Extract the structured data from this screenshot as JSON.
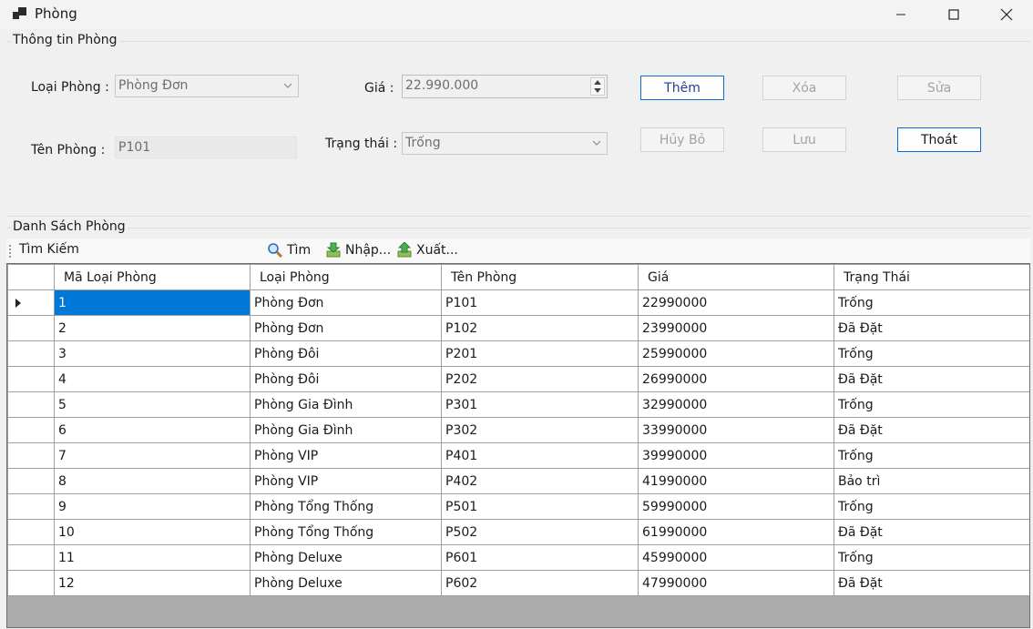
{
  "window": {
    "title": "Phòng"
  },
  "info_group": {
    "title": "Thông tin Phòng",
    "loai_phong_label": "Loại Phòng :",
    "loai_phong_value": "Phòng Đơn",
    "gia_label": "Giá :",
    "gia_value": "22.990.000",
    "ten_phong_label": "Tên Phòng :",
    "ten_phong_value": "P101",
    "trang_thai_label": "Trạng thái :",
    "trang_thai_value": "Trống"
  },
  "buttons": {
    "them": "Thêm",
    "xoa": "Xóa",
    "sua": "Sửa",
    "huy_bo": "Hủy Bỏ",
    "luu": "Lưu",
    "thoat": "Thoát"
  },
  "list_group": {
    "title": "Danh Sách Phòng"
  },
  "toolbar": {
    "search_label": "Tìm Kiếm",
    "tim": "Tìm",
    "nhap": "Nhập...",
    "xuat": "Xuất..."
  },
  "table": {
    "columns": [
      "Mã Loại Phòng",
      "Loại Phòng",
      "Tên Phòng",
      "Giá",
      "Trạng Thái"
    ],
    "rows": [
      [
        "1",
        "Phòng Đơn",
        "P101",
        "22990000",
        "Trống"
      ],
      [
        "2",
        "Phòng Đơn",
        "P102",
        "23990000",
        "Đã Đặt"
      ],
      [
        "3",
        "Phòng Đôi",
        "P201",
        "25990000",
        "Trống"
      ],
      [
        "4",
        "Phòng Đôi",
        "P202",
        "26990000",
        "Đã Đặt"
      ],
      [
        "5",
        "Phòng Gia Đình",
        "P301",
        "32990000",
        "Trống"
      ],
      [
        "6",
        "Phòng Gia Đình",
        "P302",
        "33990000",
        "Đã Đặt"
      ],
      [
        "7",
        "Phòng VIP",
        "P401",
        "39990000",
        "Trống"
      ],
      [
        "8",
        "Phòng VIP",
        "P402",
        "41990000",
        "Bảo trì"
      ],
      [
        "9",
        "Phòng Tổng Thống",
        "P501",
        "59990000",
        "Trống"
      ],
      [
        "10",
        "Phòng Tổng Thống",
        "P502",
        "61990000",
        "Đã Đặt"
      ],
      [
        "11",
        "Phòng Deluxe",
        "P601",
        "45990000",
        "Trống"
      ],
      [
        "12",
        "Phòng Deluxe",
        "P602",
        "47990000",
        "Đã Đặt"
      ]
    ]
  },
  "colors": {
    "selection": "#0078d7",
    "focus_border": "#0b6cd1"
  },
  "icons": [
    "app-icon",
    "minimize-icon",
    "maximize-icon",
    "close-icon",
    "search-icon",
    "import-icon",
    "export-icon",
    "row-pointer-icon"
  ]
}
